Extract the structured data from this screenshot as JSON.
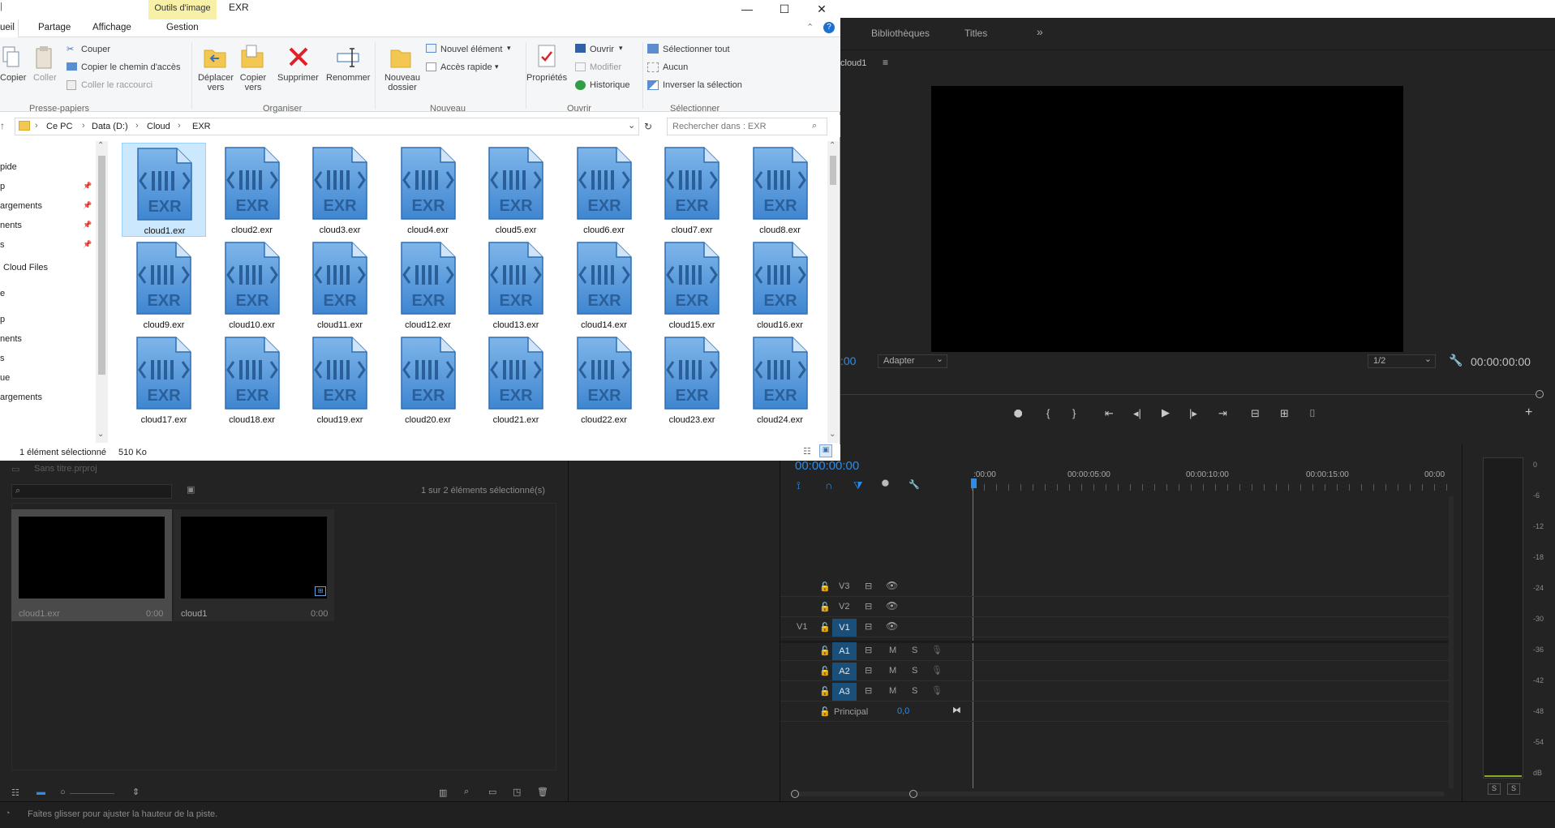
{
  "explorer": {
    "context_tab": "Outils d'image",
    "title": "EXR",
    "window_buttons": [
      "—",
      "☐",
      "✕"
    ],
    "ribbon_tabs": [
      "ueil",
      "Partage",
      "Affichage",
      "Gestion"
    ],
    "ribbon": {
      "clipboard": {
        "copy": "Copier",
        "paste": "Coller",
        "cut": "Couper",
        "copy_path": "Copier le chemin d'accès",
        "paste_shortcut": "Coller le raccourci",
        "group": "Presse-papiers"
      },
      "organize": {
        "move": "Déplacer vers",
        "copy_to": "Copier vers",
        "delete": "Supprimer",
        "rename": "Renommer",
        "group": "Organiser"
      },
      "new": {
        "new_folder": "Nouveau dossier",
        "new_item": "Nouvel élément",
        "quick_access": "Accès rapide",
        "group": "Nouveau"
      },
      "open": {
        "properties": "Propriétés",
        "open": "Ouvrir",
        "edit": "Modifier",
        "history": "Historique",
        "group": "Ouvrir"
      },
      "select": {
        "select_all": "Sélectionner tout",
        "none": "Aucun",
        "invert": "Inverser la sélection",
        "group": "Sélectionner"
      }
    },
    "breadcrumb": [
      "Ce PC",
      "Data (D:)",
      "Cloud",
      "EXR"
    ],
    "search_placeholder": "Rechercher dans : EXR",
    "nav": [
      {
        "label": "pide",
        "pinned": false
      },
      {
        "label": "p",
        "pinned": true
      },
      {
        "label": "argements",
        "pinned": true
      },
      {
        "label": "nents",
        "pinned": true
      },
      {
        "label": "s",
        "pinned": true
      },
      {
        "label": "Cloud Files",
        "pinned": false
      },
      {
        "label": "e",
        "pinned": false
      },
      {
        "label": "p",
        "pinned": false
      },
      {
        "label": "nents",
        "pinned": false
      },
      {
        "label": "s",
        "pinned": false
      },
      {
        "label": "ue",
        "pinned": false
      },
      {
        "label": "argements",
        "pinned": false
      }
    ],
    "file_badge": "EXR",
    "files": [
      "cloud1.exr",
      "cloud2.exr",
      "cloud3.exr",
      "cloud4.exr",
      "cloud5.exr",
      "cloud6.exr",
      "cloud7.exr",
      "cloud8.exr",
      "cloud9.exr",
      "cloud10.exr",
      "cloud11.exr",
      "cloud12.exr",
      "cloud13.exr",
      "cloud14.exr",
      "cloud15.exr",
      "cloud16.exr",
      "cloud17.exr",
      "cloud18.exr",
      "cloud19.exr",
      "cloud20.exr",
      "cloud21.exr",
      "cloud22.exr",
      "cloud23.exr",
      "cloud24.exr"
    ],
    "selected_file": "cloud1.exr",
    "status": {
      "selected": "1 élément sélectionné",
      "size": "510 Ko"
    }
  },
  "premiere": {
    "tabs": [
      "Bibliothèques",
      "Titles"
    ],
    "program_sequence": "cloud1",
    "program_timecode_left": ":00",
    "fit": "Adapter",
    "resolution": "1/2",
    "program_timecode_right": "00:00:00:00",
    "project": {
      "name": "Sans titre.prproj",
      "selection_info": "1 sur 2 éléments sélectionné(s)",
      "items": [
        {
          "name": "cloud1.exr",
          "duration": "0:00"
        },
        {
          "name": "cloud1",
          "duration": "0:00"
        }
      ]
    },
    "timeline": {
      "timecode": "00:00:00:00",
      "ruler": [
        ":00:00",
        "00:00:05:00",
        "00:00:10:00",
        "00:00:15:00",
        "00:00"
      ],
      "video_tracks": [
        "V3",
        "V2",
        "V1"
      ],
      "source_patch": "V1",
      "audio_tracks": [
        "A1",
        "A2",
        "A3"
      ],
      "mute": "M",
      "solo": "S",
      "master": {
        "label": "Principal",
        "value": "0,0"
      }
    },
    "meter_scale": [
      "0",
      "-6",
      "-12",
      "-18",
      "-24",
      "-30",
      "-36",
      "-42",
      "-48",
      "-54",
      "dB"
    ],
    "meter_solo": [
      "S",
      "S"
    ],
    "status": "Faites glisser pour ajuster la hauteur de la piste."
  }
}
